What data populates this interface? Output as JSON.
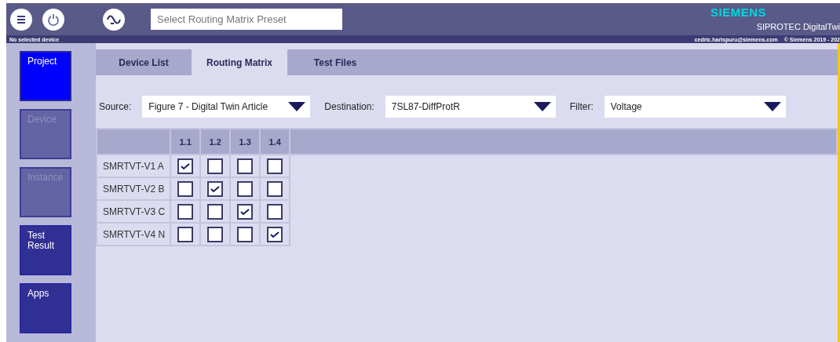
{
  "header": {
    "preset": {
      "placeholder": "Select Routing Matrix Preset"
    },
    "brand": "SIEMENS",
    "product": "SIPROTEC DigitalTwi",
    "device_status": "No selected device",
    "user": "cedric.harispuru@siemens.com",
    "copyright": "© Siemens 2019 - 202"
  },
  "sidebar": {
    "items": [
      {
        "label": "Project",
        "selected": true,
        "disabled": false
      },
      {
        "label": "Device",
        "selected": false,
        "disabled": true
      },
      {
        "label": "Instance",
        "selected": false,
        "disabled": true
      },
      {
        "label": "Test Result",
        "selected": false,
        "disabled": false
      },
      {
        "label": "Apps",
        "selected": false,
        "disabled": false
      }
    ]
  },
  "tabs": [
    {
      "label": "Device List",
      "selected": false
    },
    {
      "label": "Routing Matrix",
      "selected": true
    },
    {
      "label": "Test Files",
      "selected": false
    }
  ],
  "filters": [
    {
      "label": "Source:",
      "value": "Figure 7 - Digital Twin Article"
    },
    {
      "label": "Destination:",
      "value": "7SL87-DiffProtR"
    },
    {
      "label": "Filter:",
      "value": "Voltage"
    }
  ],
  "matrix": {
    "columns": [
      "1.1",
      "1.2",
      "1.3",
      "1.4"
    ],
    "rows": [
      {
        "name": "SMRTVT-V1 A",
        "checked": [
          true,
          false,
          false,
          false
        ]
      },
      {
        "name": "SMRTVT-V2 B",
        "checked": [
          false,
          true,
          false,
          false
        ]
      },
      {
        "name": "SMRTVT-V3 C",
        "checked": [
          false,
          false,
          true,
          false
        ]
      },
      {
        "name": "SMRTVT-V4 N",
        "checked": [
          false,
          false,
          false,
          true
        ]
      }
    ]
  }
}
